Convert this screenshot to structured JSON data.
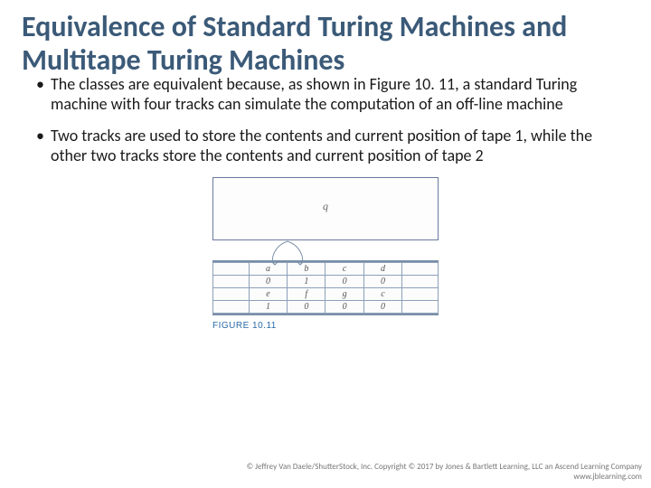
{
  "title": "Equivalence of Standard Turing Machines and Multitape Turing Machines",
  "bullets": [
    "The classes are equivalent because, as shown in Figure 10. 11, a standard Turing machine with four tracks can simulate the computation of an off-line machine",
    "Two tracks are used to store the contents and current position of tape 1, while the other two tracks store the contents and current position of tape 2"
  ],
  "figure": {
    "state_label": "q",
    "caption": "FIGURE 10.11",
    "tracks": [
      [
        "a",
        "b",
        "c",
        "d"
      ],
      [
        "0",
        "1",
        "0",
        "0"
      ],
      [
        "e",
        "f",
        "g",
        "c"
      ],
      [
        "1",
        "0",
        "0",
        "0"
      ]
    ]
  },
  "copyright_line1": "© Jeffrey Van Daele/ShutterStock, Inc. Copyright © 2017 by Jones & Bartlett Learning, LLC an Ascend Learning Company",
  "copyright_line2": "www.jblearning.com"
}
